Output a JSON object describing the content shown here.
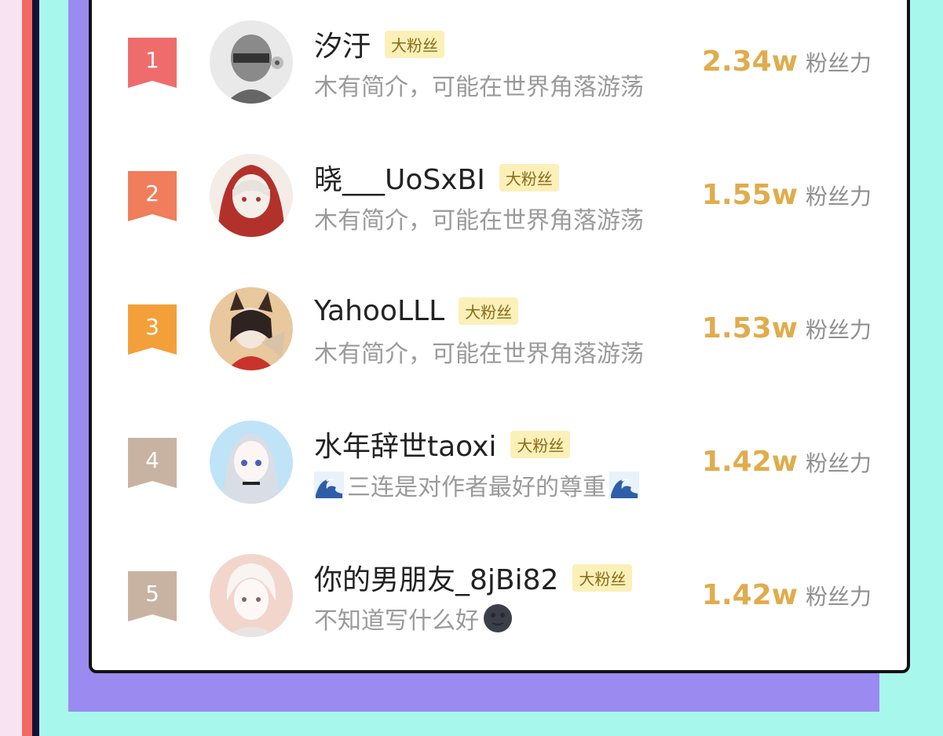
{
  "colors": {
    "background": "#a8f7ec",
    "purple_card": "#9b8af0",
    "rank_1": "#ee6c6c",
    "rank_2": "#f07d5b",
    "rank_3": "#f3a03a",
    "rank_other": "#c8b3a2",
    "score": "#e0ac4c",
    "badge_bg": "#fbf0b8"
  },
  "ranking": [
    {
      "rank": "1",
      "name": "汐汙",
      "badge": "大粉丝",
      "bio": "木有简介，可能在世界角落游荡",
      "score": "2.34w",
      "unit": "粉丝力",
      "avatar": "avatar-gray-masked"
    },
    {
      "rank": "2",
      "name": "晓___UoSxBI",
      "badge": "大粉丝",
      "bio": "木有简介，可能在世界角落游荡",
      "score": "1.55w",
      "unit": "粉丝力",
      "avatar": "avatar-red-hood-girl"
    },
    {
      "rank": "3",
      "name": "YahooLLL",
      "badge": "大粉丝",
      "bio": "木有简介，可能在世界角落游荡",
      "score": "1.53w",
      "unit": "粉丝力",
      "avatar": "avatar-fox-girl"
    },
    {
      "rank": "4",
      "name": "水年辞世taoxi",
      "badge": "大粉丝",
      "bio": "三连是对作者最好的尊重",
      "bio_icon": "wave-icon",
      "score": "1.42w",
      "unit": "粉丝力",
      "avatar": "avatar-silver-girl"
    },
    {
      "rank": "5",
      "name": "你的男朋友_8jBi82",
      "badge": "大粉丝",
      "bio": "不知道写什么好",
      "bio_icon": "new-moon-icon",
      "score": "1.42w",
      "unit": "粉丝力",
      "avatar": "avatar-white-hair-boy"
    }
  ]
}
